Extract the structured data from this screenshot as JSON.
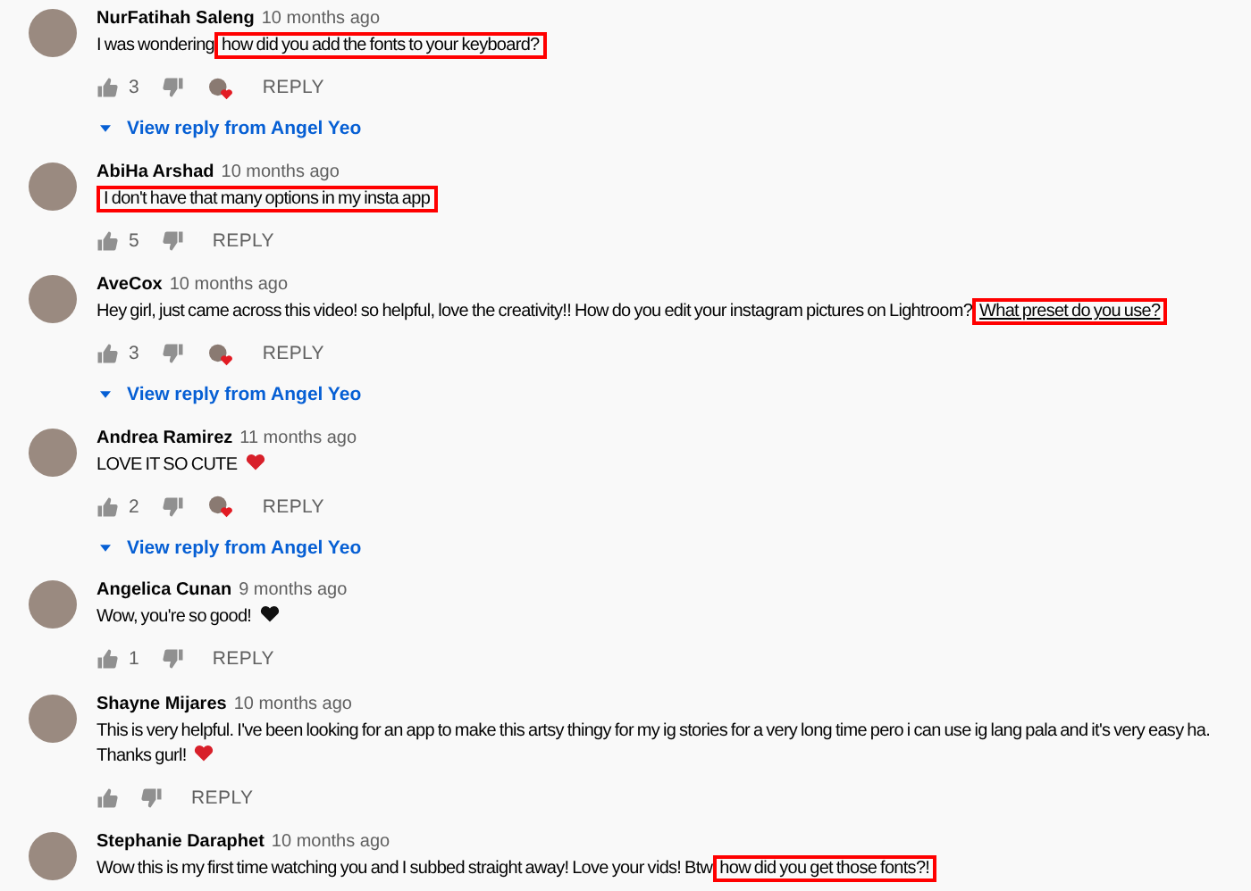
{
  "comments": [
    {
      "author": "NurFatihah Saleng",
      "time": "10 months ago",
      "lines": [
        [
          {
            "kind": "text",
            "text": "I was wondering",
            "highlighted": false
          },
          {
            "kind": "text",
            "text": "how did you add the fonts to your keyboard?",
            "highlighted": true,
            "underlined": false
          }
        ]
      ],
      "likes": "3",
      "hearted": true,
      "reply": "REPLY",
      "view_reply": "View reply from Angel Yeo"
    },
    {
      "author": "AbiHa Arshad",
      "time": "10 months ago",
      "lines": [
        [
          {
            "kind": "text",
            "text": "I don't have that many options in my insta app",
            "highlighted": true,
            "underlined": false
          }
        ]
      ],
      "likes": "5",
      "hearted": false,
      "reply": "REPLY"
    },
    {
      "author": "AveCox",
      "time": "10 months ago",
      "lines": [
        [
          {
            "kind": "text",
            "text": "Hey girl, just came across this video! so helpful, love the creativity!! How do you edit your instagram pictures on Lightroom?",
            "highlighted": false
          },
          {
            "kind": "text",
            "text": "What preset do you use?",
            "highlighted": true,
            "underlined": true
          }
        ]
      ],
      "likes": "3",
      "hearted": true,
      "reply": "REPLY",
      "view_reply": "View reply from Angel Yeo"
    },
    {
      "author": "Andrea Ramirez",
      "time": "11 months ago",
      "lines": [
        [
          {
            "kind": "text",
            "text": "LOVE IT SO CUTE",
            "highlighted": false
          },
          {
            "kind": "emoji",
            "color": "#d8202a"
          }
        ]
      ],
      "likes": "2",
      "hearted": true,
      "reply": "REPLY",
      "view_reply": "View reply from Angel Yeo"
    },
    {
      "author": "Angelica Cunan",
      "time": "9 months ago",
      "lines": [
        [
          {
            "kind": "text",
            "text": "Wow, you're so good!",
            "highlighted": false
          },
          {
            "kind": "emoji",
            "color": "#111111"
          }
        ]
      ],
      "likes": "1",
      "hearted": false,
      "reply": "REPLY"
    },
    {
      "author": "Shayne Mijares",
      "time": "10 months ago",
      "lines": [
        [
          {
            "kind": "text",
            "text": "This is very helpful. I've been looking for an app to make this artsy thingy for my ig stories for a very long time pero i can use ig lang pala and it's very easy ha.",
            "highlighted": false
          }
        ],
        [
          {
            "kind": "text",
            "text": "Thanks gurl!",
            "highlighted": false
          },
          {
            "kind": "emoji",
            "color": "#d8202a"
          }
        ]
      ],
      "hearted": false,
      "reply": "REPLY"
    },
    {
      "author": "Stephanie Daraphet",
      "time": "10 months ago",
      "lines": [
        [
          {
            "kind": "text",
            "text": "Wow this is my first time watching you and I subbed straight away! Love your vids! Btw",
            "highlighted": false
          },
          {
            "kind": "text",
            "text": "how did you get those fonts?!",
            "highlighted": true,
            "underlined": false
          }
        ]
      ]
    }
  ]
}
